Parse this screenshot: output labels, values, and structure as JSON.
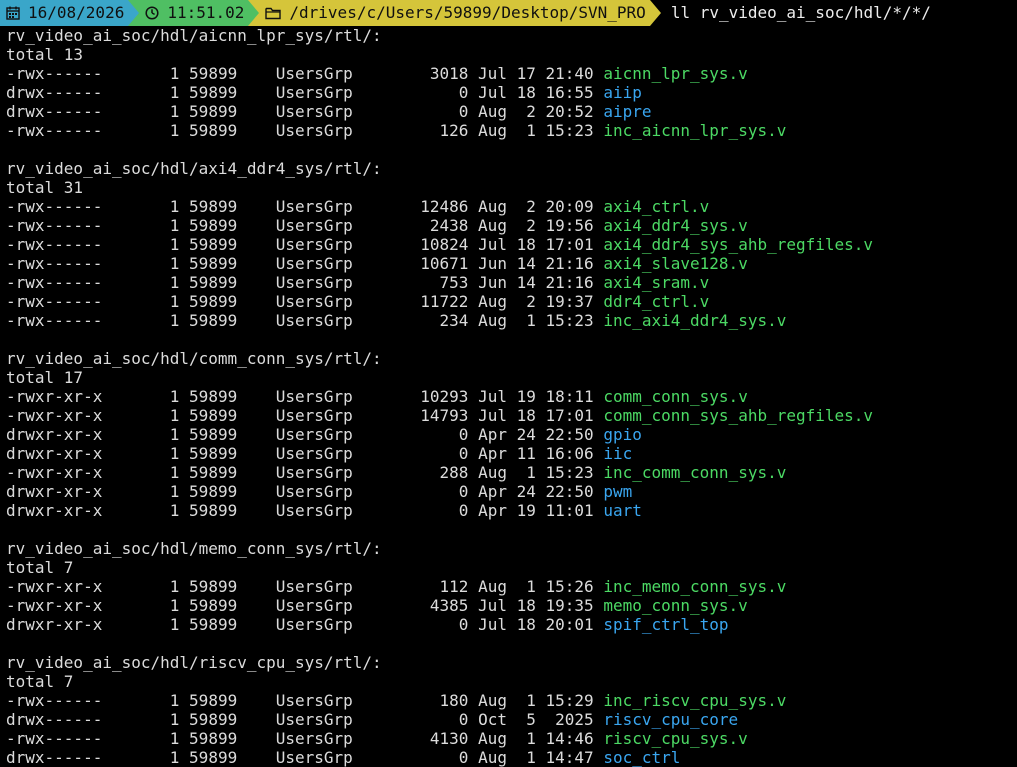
{
  "prompt": {
    "date": "16/08/2026",
    "time": "11:51.02",
    "path": "/drives/c/Users/59899/Desktop/SVN_PRO",
    "command": "ll rv_video_ai_soc/hdl/*/*/",
    "date_icon": "calendar-icon",
    "time_icon": "clock-icon",
    "path_icon": "folder-icon",
    "colors": {
      "date_bg": "#3aa6c9",
      "time_bg": "#4fbf63",
      "path_bg": "#d5c53a",
      "file_name": "#4cd964",
      "dir_name": "#3aa6f0"
    }
  },
  "listings": [
    {
      "header": "rv_video_ai_soc/hdl/aicnn_lpr_sys/rtl/:",
      "total": "total 13",
      "entries": [
        {
          "perms": "-rwx------",
          "links": "1",
          "owner": "59899",
          "group": "UsersGrp",
          "size": "3018",
          "month": "Jul",
          "day": "17",
          "time": "21:40",
          "name": "aicnn_lpr_sys.v",
          "kind": "file"
        },
        {
          "perms": "drwx------",
          "links": "1",
          "owner": "59899",
          "group": "UsersGrp",
          "size": "0",
          "month": "Jul",
          "day": "18",
          "time": "16:55",
          "name": "aiip",
          "kind": "dir"
        },
        {
          "perms": "drwx------",
          "links": "1",
          "owner": "59899",
          "group": "UsersGrp",
          "size": "0",
          "month": "Aug",
          "day": "2",
          "time": "20:52",
          "name": "aipre",
          "kind": "dir"
        },
        {
          "perms": "-rwx------",
          "links": "1",
          "owner": "59899",
          "group": "UsersGrp",
          "size": "126",
          "month": "Aug",
          "day": "1",
          "time": "15:23",
          "name": "inc_aicnn_lpr_sys.v",
          "kind": "file"
        }
      ]
    },
    {
      "header": "rv_video_ai_soc/hdl/axi4_ddr4_sys/rtl/:",
      "total": "total 31",
      "entries": [
        {
          "perms": "-rwx------",
          "links": "1",
          "owner": "59899",
          "group": "UsersGrp",
          "size": "12486",
          "month": "Aug",
          "day": "2",
          "time": "20:09",
          "name": "axi4_ctrl.v",
          "kind": "file"
        },
        {
          "perms": "-rwx------",
          "links": "1",
          "owner": "59899",
          "group": "UsersGrp",
          "size": "2438",
          "month": "Aug",
          "day": "2",
          "time": "19:56",
          "name": "axi4_ddr4_sys.v",
          "kind": "file"
        },
        {
          "perms": "-rwx------",
          "links": "1",
          "owner": "59899",
          "group": "UsersGrp",
          "size": "10824",
          "month": "Jul",
          "day": "18",
          "time": "17:01",
          "name": "axi4_ddr4_sys_ahb_regfiles.v",
          "kind": "file"
        },
        {
          "perms": "-rwx------",
          "links": "1",
          "owner": "59899",
          "group": "UsersGrp",
          "size": "10671",
          "month": "Jun",
          "day": "14",
          "time": "21:16",
          "name": "axi4_slave128.v",
          "kind": "file"
        },
        {
          "perms": "-rwx------",
          "links": "1",
          "owner": "59899",
          "group": "UsersGrp",
          "size": "753",
          "month": "Jun",
          "day": "14",
          "time": "21:16",
          "name": "axi4_sram.v",
          "kind": "file"
        },
        {
          "perms": "-rwx------",
          "links": "1",
          "owner": "59899",
          "group": "UsersGrp",
          "size": "11722",
          "month": "Aug",
          "day": "2",
          "time": "19:37",
          "name": "ddr4_ctrl.v",
          "kind": "file"
        },
        {
          "perms": "-rwx------",
          "links": "1",
          "owner": "59899",
          "group": "UsersGrp",
          "size": "234",
          "month": "Aug",
          "day": "1",
          "time": "15:23",
          "name": "inc_axi4_ddr4_sys.v",
          "kind": "file"
        }
      ]
    },
    {
      "header": "rv_video_ai_soc/hdl/comm_conn_sys/rtl/:",
      "total": "total 17",
      "entries": [
        {
          "perms": "-rwxr-xr-x",
          "links": "1",
          "owner": "59899",
          "group": "UsersGrp",
          "size": "10293",
          "month": "Jul",
          "day": "19",
          "time": "18:11",
          "name": "comm_conn_sys.v",
          "kind": "file"
        },
        {
          "perms": "-rwxr-xr-x",
          "links": "1",
          "owner": "59899",
          "group": "UsersGrp",
          "size": "14793",
          "month": "Jul",
          "day": "18",
          "time": "17:01",
          "name": "comm_conn_sys_ahb_regfiles.v",
          "kind": "file"
        },
        {
          "perms": "drwxr-xr-x",
          "links": "1",
          "owner": "59899",
          "group": "UsersGrp",
          "size": "0",
          "month": "Apr",
          "day": "24",
          "time": "22:50",
          "name": "gpio",
          "kind": "dir"
        },
        {
          "perms": "drwxr-xr-x",
          "links": "1",
          "owner": "59899",
          "group": "UsersGrp",
          "size": "0",
          "month": "Apr",
          "day": "11",
          "time": "16:06",
          "name": "iic",
          "kind": "dir"
        },
        {
          "perms": "-rwxr-xr-x",
          "links": "1",
          "owner": "59899",
          "group": "UsersGrp",
          "size": "288",
          "month": "Aug",
          "day": "1",
          "time": "15:23",
          "name": "inc_comm_conn_sys.v",
          "kind": "file"
        },
        {
          "perms": "drwxr-xr-x",
          "links": "1",
          "owner": "59899",
          "group": "UsersGrp",
          "size": "0",
          "month": "Apr",
          "day": "24",
          "time": "22:50",
          "name": "pwm",
          "kind": "dir"
        },
        {
          "perms": "drwxr-xr-x",
          "links": "1",
          "owner": "59899",
          "group": "UsersGrp",
          "size": "0",
          "month": "Apr",
          "day": "19",
          "time": "11:01",
          "name": "uart",
          "kind": "dir"
        }
      ]
    },
    {
      "header": "rv_video_ai_soc/hdl/memo_conn_sys/rtl/:",
      "total": "total 7",
      "entries": [
        {
          "perms": "-rwxr-xr-x",
          "links": "1",
          "owner": "59899",
          "group": "UsersGrp",
          "size": "112",
          "month": "Aug",
          "day": "1",
          "time": "15:26",
          "name": "inc_memo_conn_sys.v",
          "kind": "file"
        },
        {
          "perms": "-rwxr-xr-x",
          "links": "1",
          "owner": "59899",
          "group": "UsersGrp",
          "size": "4385",
          "month": "Jul",
          "day": "18",
          "time": "19:35",
          "name": "memo_conn_sys.v",
          "kind": "file"
        },
        {
          "perms": "drwxr-xr-x",
          "links": "1",
          "owner": "59899",
          "group": "UsersGrp",
          "size": "0",
          "month": "Jul",
          "day": "18",
          "time": "20:01",
          "name": "spif_ctrl_top",
          "kind": "dir"
        }
      ]
    },
    {
      "header": "rv_video_ai_soc/hdl/riscv_cpu_sys/rtl/:",
      "total": "total 7",
      "entries": [
        {
          "perms": "-rwx------",
          "links": "1",
          "owner": "59899",
          "group": "UsersGrp",
          "size": "180",
          "month": "Aug",
          "day": "1",
          "time": "15:29",
          "name": "inc_riscv_cpu_sys.v",
          "kind": "file"
        },
        {
          "perms": "drwx------",
          "links": "1",
          "owner": "59899",
          "group": "UsersGrp",
          "size": "0",
          "month": "Oct",
          "day": "5",
          "time": "2025",
          "name": "riscv_cpu_core",
          "kind": "dir"
        },
        {
          "perms": "-rwx------",
          "links": "1",
          "owner": "59899",
          "group": "UsersGrp",
          "size": "4130",
          "month": "Aug",
          "day": "1",
          "time": "14:46",
          "name": "riscv_cpu_sys.v",
          "kind": "file"
        },
        {
          "perms": "drwx------",
          "links": "1",
          "owner": "59899",
          "group": "UsersGrp",
          "size": "0",
          "month": "Aug",
          "day": "1",
          "time": "14:47",
          "name": "soc_ctrl",
          "kind": "dir"
        }
      ]
    }
  ]
}
